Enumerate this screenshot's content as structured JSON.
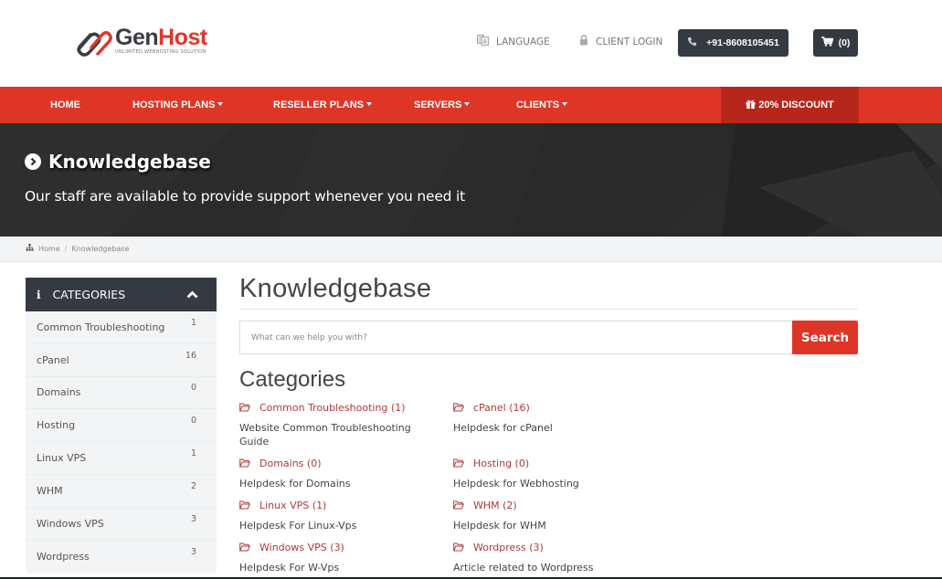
{
  "header": {
    "logo": {
      "name_part1": "Gen",
      "name_part2": "Host",
      "tagline": "UNLIMITED WEBHOSTING SOLUTION"
    },
    "language_label": "LANGUAGE",
    "client_login_label": "CLIENT LOGIN",
    "phone": "+91-8608105451",
    "cart_count": "(0)"
  },
  "nav": {
    "items": [
      {
        "label": "HOME",
        "dropdown": false
      },
      {
        "label": "HOSTING PLANS",
        "dropdown": true
      },
      {
        "label": "RESELLER PLANS",
        "dropdown": true
      },
      {
        "label": "SERVERS",
        "dropdown": true
      },
      {
        "label": "CLIENTS",
        "dropdown": true
      }
    ],
    "discount_label": "20% DISCOUNT"
  },
  "banner": {
    "title": "Knowledgebase",
    "subtitle": "Our staff are available to provide support whenever you need it"
  },
  "breadcrumb": {
    "items": [
      "Home",
      "Knowledgebase"
    ]
  },
  "sidebar": {
    "title": "CATEGORIES",
    "items": [
      {
        "label": "Common Troubleshooting",
        "count": "1"
      },
      {
        "label": "cPanel",
        "count": "16"
      },
      {
        "label": "Domains",
        "count": "0"
      },
      {
        "label": "Hosting",
        "count": "0"
      },
      {
        "label": "Linux VPS",
        "count": "1"
      },
      {
        "label": "WHM",
        "count": "2"
      },
      {
        "label": "Windows VPS",
        "count": "3"
      },
      {
        "label": "Wordpress",
        "count": "3"
      }
    ]
  },
  "main": {
    "title": "Knowledgebase",
    "search_placeholder": "What can we help you with?",
    "search_button": "Search",
    "categories_title": "Categories",
    "categories": [
      {
        "label": "Common Troubleshooting (1)",
        "description": "Website Common Troubleshooting Guide"
      },
      {
        "label": "cPanel (16)",
        "description": "Helpdesk for cPanel"
      },
      {
        "label": "Domains (0)",
        "description": "Helpdesk for Domains"
      },
      {
        "label": "Hosting (0)",
        "description": "Helpdesk for Webhosting"
      },
      {
        "label": "Linux VPS (1)",
        "description": "Helpdesk For Linux-Vps"
      },
      {
        "label": "WHM (2)",
        "description": "Helpdesk for WHM"
      },
      {
        "label": "Windows VPS (3)",
        "description": "Helpdesk For W-Vps"
      },
      {
        "label": "Wordpress (3)",
        "description": "Article related to Wordpress"
      }
    ]
  },
  "colors": {
    "brand_red": "#df3526",
    "discount_red": "#b7261b",
    "dark": "#353a42",
    "link_red": "#b03a3a"
  }
}
